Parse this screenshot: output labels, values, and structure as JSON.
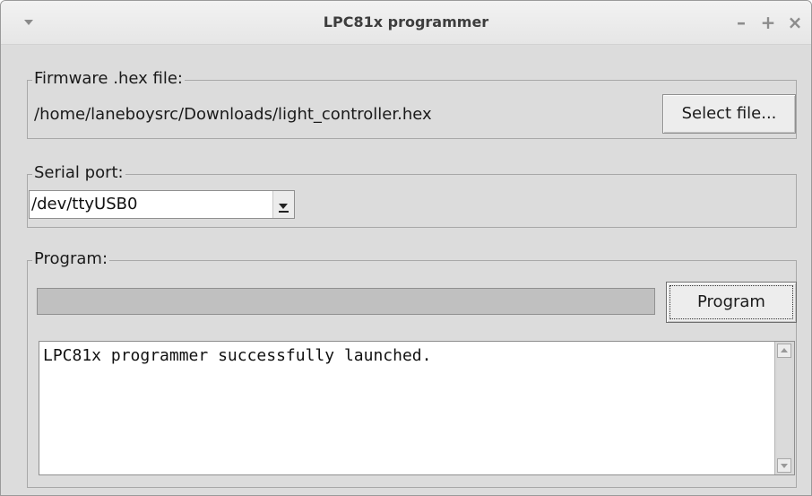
{
  "window": {
    "title": "LPC81x programmer",
    "controls": {
      "minimize": "–",
      "maximize": "+",
      "close": "×"
    }
  },
  "firmware": {
    "legend": "Firmware .hex file:",
    "path": "/home/laneboysrc/Downloads/light_controller.hex",
    "select_button": "Select file..."
  },
  "serial": {
    "legend": "Serial port:",
    "selected": "/dev/ttyUSB0"
  },
  "program": {
    "legend": "Program:",
    "button": "Program",
    "progress": 0,
    "log": "LPC81x programmer successfully launched."
  },
  "icons": [
    "window-menu-icon",
    "minimize-icon",
    "maximize-icon",
    "close-icon",
    "dropdown-arrow-icon",
    "scroll-up-icon",
    "scroll-down-icon"
  ]
}
